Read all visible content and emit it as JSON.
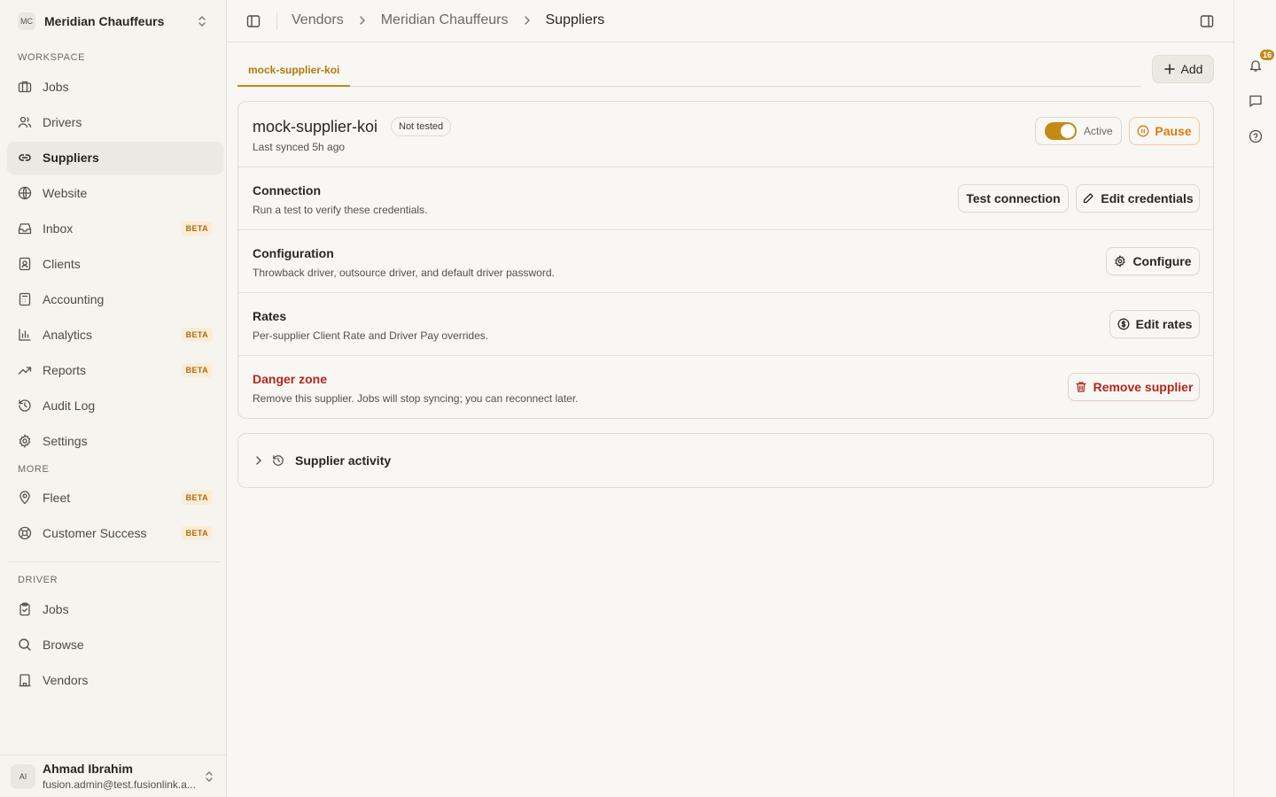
{
  "org": {
    "initials": "MC",
    "name": "Meridian Chauffeurs"
  },
  "sidebar": {
    "workspace_label": "WORKSPACE",
    "more_label": "MORE",
    "driver_label": "DRIVER",
    "workspace_items": [
      {
        "label": "Jobs",
        "icon": "briefcase-icon"
      },
      {
        "label": "Drivers",
        "icon": "users-icon"
      },
      {
        "label": "Suppliers",
        "icon": "link-icon",
        "active": true
      },
      {
        "label": "Website",
        "icon": "globe-icon"
      },
      {
        "label": "Inbox",
        "icon": "inbox-icon",
        "badge": "BETA"
      },
      {
        "label": "Clients",
        "icon": "contact-icon"
      },
      {
        "label": "Accounting",
        "icon": "calculator-icon"
      },
      {
        "label": "Analytics",
        "icon": "bar-chart-icon",
        "badge": "BETA"
      },
      {
        "label": "Reports",
        "icon": "trend-icon",
        "badge": "BETA"
      },
      {
        "label": "Audit Log",
        "icon": "history-icon"
      },
      {
        "label": "Settings",
        "icon": "gear-icon"
      }
    ],
    "more_items": [
      {
        "label": "Fleet",
        "icon": "map-pin-icon",
        "badge": "BETA"
      },
      {
        "label": "Customer Success",
        "icon": "lifebuoy-icon",
        "badge": "BETA"
      }
    ],
    "driver_items": [
      {
        "label": "Jobs",
        "icon": "clipboard-icon"
      },
      {
        "label": "Browse",
        "icon": "search-icon"
      },
      {
        "label": "Vendors",
        "icon": "building-icon"
      }
    ]
  },
  "user": {
    "initials": "AI",
    "name": "Ahmad Ibrahim",
    "email": "fusion.admin@test.fusionlink.a..."
  },
  "breadcrumbs": [
    "Vendors",
    "Meridian Chauffeurs",
    "Suppliers"
  ],
  "notifications": {
    "count": "16"
  },
  "tabs": [
    {
      "label": "mock-supplier-koi",
      "active": true
    }
  ],
  "add_label": "Add",
  "supplier": {
    "name": "mock-supplier-koi",
    "status_pill": "Not tested",
    "last_synced": "Last synced 5h ago",
    "active_label": "Active",
    "active": true,
    "pause_label": "Pause"
  },
  "sections": {
    "connection": {
      "title": "Connection",
      "desc": "Run a test to verify these credentials.",
      "test_label": "Test connection",
      "edit_label": "Edit credentials"
    },
    "configuration": {
      "title": "Configuration",
      "desc": "Throwback driver, outsource driver, and default driver password.",
      "button_label": "Configure"
    },
    "rates": {
      "title": "Rates",
      "desc": "Per-supplier Client Rate and Driver Pay overrides.",
      "button_label": "Edit rates"
    },
    "danger": {
      "title": "Danger zone",
      "desc": "Remove this supplier. Jobs will stop syncing; you can reconnect later.",
      "button_label": "Remove supplier"
    }
  },
  "activity": {
    "label": "Supplier activity"
  },
  "colors": {
    "accent": "#c48a14",
    "danger": "#b3261e",
    "beta": "#b06a12"
  }
}
